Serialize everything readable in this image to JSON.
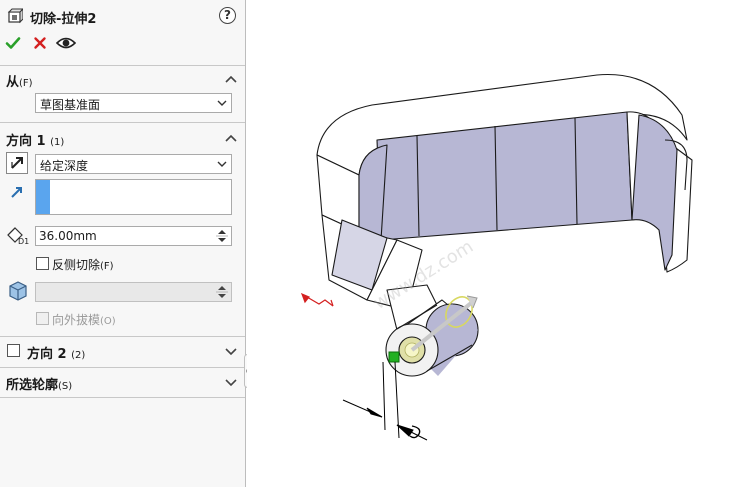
{
  "feature": {
    "title": "切除-拉伸2",
    "help_icon": "?",
    "icon": "extrude-cut-icon"
  },
  "actions": {
    "ok": "ok-check-icon",
    "cancel": "cancel-x-icon",
    "preview": "eye-icon"
  },
  "from_section": {
    "label": "从",
    "shortcut": "(F)",
    "start_condition": "草图基准面"
  },
  "direction1": {
    "label": "方向 1",
    "shortcut": "(1)",
    "end_condition": "给定深度",
    "depth": "36.00mm",
    "flip_side_label": "反侧切除",
    "flip_side_shortcut": "(F)",
    "draft_value": "",
    "draft_outward_label": "向外拔模",
    "draft_outward_shortcut": "(O)"
  },
  "direction2": {
    "label": "方向 2",
    "shortcut": "(2)"
  },
  "selected_contours": {
    "label": "所选轮廓",
    "shortcut": "(S)"
  },
  "watermark": "www.dz.com",
  "colors": {
    "accent_blue": "#5aa5ee",
    "ok_green": "#2aa02a",
    "cancel_red": "#d42020",
    "model_face": "#b7b7d4",
    "model_edge": "#1a1a1a",
    "preview_yellow": "#d8d860"
  }
}
